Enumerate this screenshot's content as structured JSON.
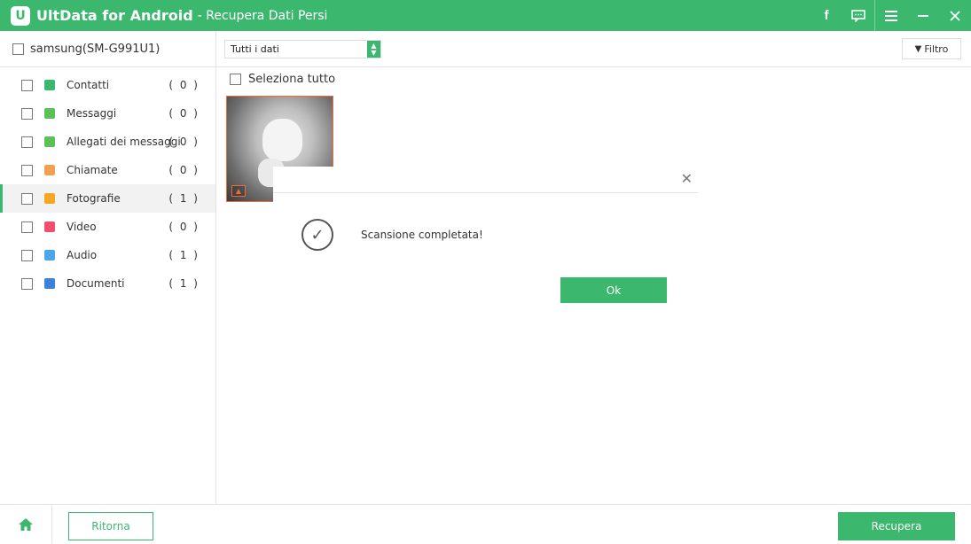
{
  "app": {
    "name": "UltData for Android",
    "subtitle": "- Recupera Dati Persi",
    "logo_letter": "U",
    "brand_color": "#3bb86d"
  },
  "titlebar_icons": [
    "facebook-icon",
    "feedback-icon",
    "menu-icon",
    "minimize-icon",
    "close-icon"
  ],
  "device": {
    "label": "samsung(SM-G991U1)"
  },
  "categories": [
    {
      "label": "Contatti",
      "count": "( 0 )",
      "icon": "contacts-icon",
      "color": "#3bb86d"
    },
    {
      "label": "Messaggi",
      "count": "( 0 )",
      "icon": "messages-icon",
      "color": "#5cc05c"
    },
    {
      "label": "Allegati dei messaggi",
      "count": "( 0 )",
      "icon": "attachments-icon",
      "color": "#5cc05c"
    },
    {
      "label": "Chiamate",
      "count": "( 0 )",
      "icon": "calls-icon",
      "color": "#f0a050"
    },
    {
      "label": "Fotografie",
      "count": "( 1 )",
      "icon": "photos-icon",
      "color": "#f5a623",
      "active": true
    },
    {
      "label": "Video",
      "count": "( 0 )",
      "icon": "video-icon",
      "color": "#f0506e"
    },
    {
      "label": "Audio",
      "count": "( 1 )",
      "icon": "audio-icon",
      "color": "#4aa8e8"
    },
    {
      "label": "Documenti",
      "count": "( 1 )",
      "icon": "documents-icon",
      "color": "#3b82d8"
    }
  ],
  "toolbar": {
    "filter_select": "Tutti i dati",
    "filter_button": "Filtro"
  },
  "select_all": "Seleziona tutto",
  "dialog": {
    "message": "Scansione completata!",
    "ok": "Ok"
  },
  "bottom": {
    "back": "Ritorna",
    "recover": "Recupera"
  }
}
